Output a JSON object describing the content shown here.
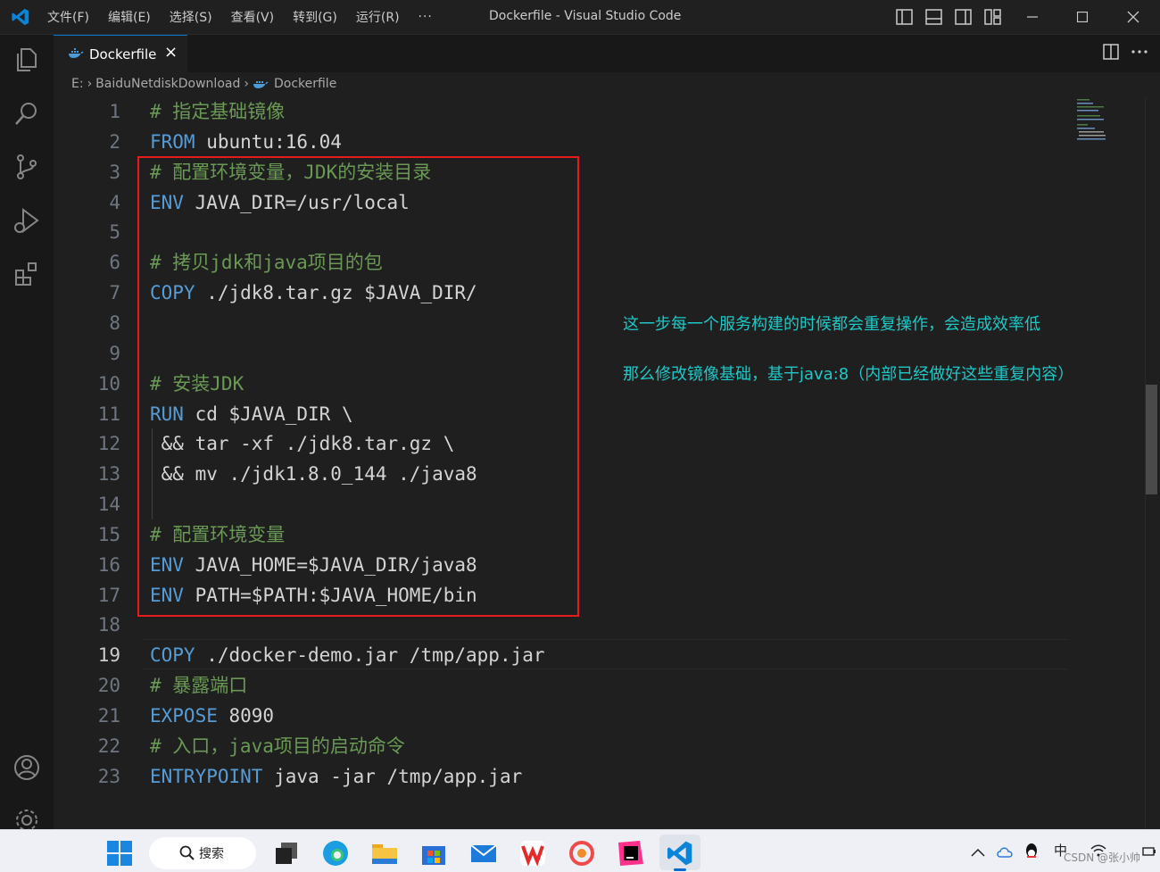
{
  "window": {
    "title": "Dockerfile - Visual Studio Code",
    "menu": [
      "文件(F)",
      "编辑(E)",
      "选择(S)",
      "查看(V)",
      "转到(G)",
      "运行(R)",
      "···"
    ]
  },
  "tab": {
    "name": "Dockerfile"
  },
  "breadcrumb": {
    "drive": "E:",
    "folder": "BaiduNetdiskDownload",
    "file": "Dockerfile"
  },
  "active_line": 19,
  "lines": [
    {
      "n": "1",
      "parts": [
        {
          "t": "# 指定基础镜像",
          "c": "cm"
        }
      ]
    },
    {
      "n": "2",
      "parts": [
        {
          "t": "FROM",
          "c": "kw"
        },
        {
          "t": " ubuntu:16.04",
          "c": ""
        }
      ]
    },
    {
      "n": "3",
      "parts": [
        {
          "t": "# 配置环境变量，JDK的安装目录",
          "c": "cm"
        }
      ]
    },
    {
      "n": "4",
      "parts": [
        {
          "t": "ENV",
          "c": "kw"
        },
        {
          "t": " JAVA_DIR=/usr/local",
          "c": ""
        }
      ]
    },
    {
      "n": "5",
      "parts": []
    },
    {
      "n": "6",
      "parts": [
        {
          "t": "# 拷贝jdk和java项目的包",
          "c": "cm"
        }
      ]
    },
    {
      "n": "7",
      "parts": [
        {
          "t": "COPY",
          "c": "kw"
        },
        {
          "t": " ./jdk8.tar.gz $JAVA_DIR/",
          "c": ""
        }
      ]
    },
    {
      "n": "8",
      "parts": []
    },
    {
      "n": "9",
      "parts": []
    },
    {
      "n": "10",
      "parts": [
        {
          "t": "# 安装JDK",
          "c": "cm"
        }
      ]
    },
    {
      "n": "11",
      "parts": [
        {
          "t": "RUN",
          "c": "kw"
        },
        {
          "t": " cd $JAVA_DIR \\",
          "c": ""
        }
      ]
    },
    {
      "n": "12",
      "parts": [
        {
          "t": " && tar -xf ./jdk8.tar.gz \\",
          "c": ""
        }
      ]
    },
    {
      "n": "13",
      "parts": [
        {
          "t": " && mv ./jdk1.8.0_144 ./java8",
          "c": ""
        }
      ]
    },
    {
      "n": "14",
      "parts": []
    },
    {
      "n": "15",
      "parts": [
        {
          "t": "# 配置环境变量",
          "c": "cm"
        }
      ]
    },
    {
      "n": "16",
      "parts": [
        {
          "t": "ENV",
          "c": "kw"
        },
        {
          "t": " JAVA_HOME=$JAVA_DIR/java8",
          "c": ""
        }
      ]
    },
    {
      "n": "17",
      "parts": [
        {
          "t": "ENV",
          "c": "kw"
        },
        {
          "t": " PATH=$PATH:$JAVA_HOME/bin",
          "c": ""
        }
      ]
    },
    {
      "n": "18",
      "parts": []
    },
    {
      "n": "19",
      "parts": [
        {
          "t": "COPY",
          "c": "kw"
        },
        {
          "t": " ./docker-demo.jar /tmp/app.jar",
          "c": ""
        }
      ]
    },
    {
      "n": "20",
      "parts": [
        {
          "t": "# 暴露端口",
          "c": "cm"
        }
      ]
    },
    {
      "n": "21",
      "parts": [
        {
          "t": "EXPOSE",
          "c": "kw"
        },
        {
          "t": " 8090",
          "c": ""
        }
      ]
    },
    {
      "n": "22",
      "parts": [
        {
          "t": "# 入口，java项目的启动命令",
          "c": "cm"
        }
      ]
    },
    {
      "n": "23",
      "parts": [
        {
          "t": "ENTRYPOINT",
          "c": "kw"
        },
        {
          "t": " java -jar /tmp/app.jar",
          "c": ""
        }
      ]
    }
  ],
  "annotations": {
    "line1": "这一步每一个服务构建的时候都会重复操作，会造成效率低",
    "line2": "那么修改镜像基础，基于java:8（内部已经做好这些重复内容）"
  },
  "taskbar": {
    "search_label": "搜索",
    "ime": "中"
  },
  "watermark": "CSDN @张小帅",
  "colors": {
    "keyword": "#569cd6",
    "comment": "#6a9955",
    "highlight_box": "#e51c1c",
    "annotation": "#1fc7c7",
    "accent": "#0078d4"
  }
}
